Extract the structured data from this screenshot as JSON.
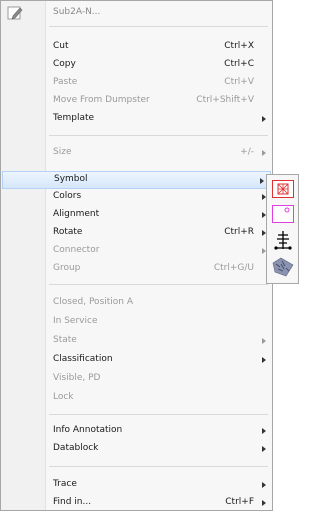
{
  "menu": {
    "header": {
      "label": "Sub2A-N...",
      "icon": "pencil-edit-icon"
    },
    "items": [
      {
        "id": "cut",
        "label": "Cut",
        "shortcut": "Ctrl+X",
        "enabled": true,
        "submenu": false
      },
      {
        "id": "copy",
        "label": "Copy",
        "shortcut": "Ctrl+C",
        "enabled": true,
        "submenu": false
      },
      {
        "id": "paste",
        "label": "Paste",
        "shortcut": "Ctrl+V",
        "enabled": false,
        "submenu": false
      },
      {
        "id": "move-from-dumpster",
        "label": "Move From Dumpster",
        "shortcut": "Ctrl+Shift+V",
        "enabled": false,
        "submenu": false
      },
      {
        "id": "template",
        "label": "Template",
        "shortcut": "",
        "enabled": true,
        "submenu": true
      },
      {
        "id": "size",
        "label": "Size",
        "shortcut": "+/-",
        "enabled": false,
        "submenu": true
      },
      {
        "id": "symbol",
        "label": "Symbol",
        "shortcut": "",
        "enabled": true,
        "submenu": true,
        "highlighted": true
      },
      {
        "id": "colors",
        "label": "Colors",
        "shortcut": "",
        "enabled": true,
        "submenu": true
      },
      {
        "id": "alignment",
        "label": "Alignment",
        "shortcut": "",
        "enabled": true,
        "submenu": true
      },
      {
        "id": "rotate",
        "label": "Rotate",
        "shortcut": "Ctrl+R",
        "enabled": true,
        "submenu": true
      },
      {
        "id": "connector",
        "label": "Connector",
        "shortcut": "",
        "enabled": false,
        "submenu": true
      },
      {
        "id": "group",
        "label": "Group",
        "shortcut": "Ctrl+G/U",
        "enabled": false,
        "submenu": false
      },
      {
        "id": "closed-position-a",
        "label": "Closed, Position A",
        "shortcut": "",
        "enabled": false,
        "submenu": false
      },
      {
        "id": "in-service",
        "label": "In Service",
        "shortcut": "",
        "enabled": false,
        "submenu": false
      },
      {
        "id": "state",
        "label": "State",
        "shortcut": "",
        "enabled": false,
        "submenu": true
      },
      {
        "id": "classification",
        "label": "Classification",
        "shortcut": "",
        "enabled": true,
        "submenu": true
      },
      {
        "id": "visible-pd",
        "label": "Visible, PD",
        "shortcut": "",
        "enabled": false,
        "submenu": false
      },
      {
        "id": "lock",
        "label": "Lock",
        "shortcut": "",
        "enabled": false,
        "submenu": false
      },
      {
        "id": "info-annotation",
        "label": "Info Annotation",
        "shortcut": "",
        "enabled": true,
        "submenu": true
      },
      {
        "id": "datablock",
        "label": "Datablock",
        "shortcut": "",
        "enabled": true,
        "submenu": true
      },
      {
        "id": "trace",
        "label": "Trace",
        "shortcut": "",
        "enabled": true,
        "submenu": true
      },
      {
        "id": "find-in",
        "label": "Find in...",
        "shortcut": "Ctrl+F",
        "enabled": true,
        "submenu": true
      }
    ]
  },
  "symbol_submenu": {
    "items": [
      {
        "id": "symbol-1",
        "icon": "red-crosshatch-box-icon",
        "color": "#e03030"
      },
      {
        "id": "symbol-2",
        "icon": "magenta-box-icon",
        "color": "#e040e0"
      },
      {
        "id": "symbol-3",
        "icon": "switch-symbol-icon",
        "color": "#000000"
      },
      {
        "id": "symbol-4",
        "icon": "texture-pattern-icon",
        "color": "#7080a0"
      }
    ]
  },
  "colors": {
    "highlight": "#cce4fb",
    "disabled_text": "#9a9a9a",
    "menu_bg": "#f7f7f7"
  }
}
